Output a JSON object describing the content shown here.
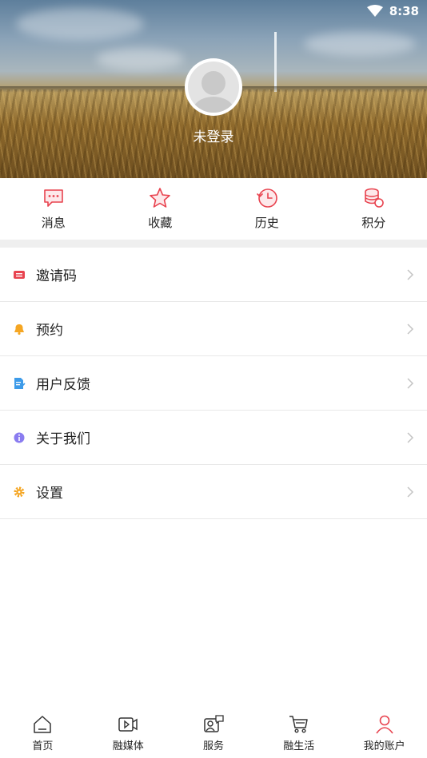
{
  "status_bar": {
    "time": "8:38"
  },
  "profile": {
    "login_label": "未登录"
  },
  "quick_actions": [
    {
      "label": "消息",
      "icon": "message-icon"
    },
    {
      "label": "收藏",
      "icon": "star-icon"
    },
    {
      "label": "历史",
      "icon": "history-icon"
    },
    {
      "label": "积分",
      "icon": "coins-icon"
    }
  ],
  "menu": [
    {
      "label": "邀请码",
      "icon": "ticket-icon",
      "color": "#e8434f"
    },
    {
      "label": "预约",
      "icon": "bell-icon",
      "color": "#f5a623"
    },
    {
      "label": "用户反馈",
      "icon": "feedback-doc-icon",
      "color": "#3d9be9"
    },
    {
      "label": "关于我们",
      "icon": "info-icon",
      "color": "#8a7cf0"
    },
    {
      "label": "设置",
      "icon": "gear-icon",
      "color": "#f5a623"
    }
  ],
  "bottom_nav": [
    {
      "label": "首页",
      "icon": "home-icon"
    },
    {
      "label": "融媒体",
      "icon": "video-icon"
    },
    {
      "label": "服务",
      "icon": "service-icon"
    },
    {
      "label": "融生活",
      "icon": "cart-icon"
    },
    {
      "label": "我的账户",
      "icon": "user-icon",
      "active": true
    }
  ],
  "colors": {
    "accent": "#e8434f",
    "divider": "#e8e8e8",
    "section_gap": "#efefef"
  }
}
